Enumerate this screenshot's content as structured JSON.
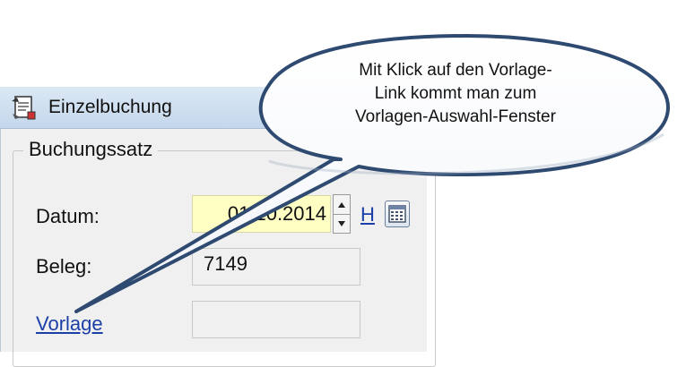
{
  "window": {
    "title": "Einzelbuchung",
    "group_title": "Buchungssatz"
  },
  "fields": {
    "datum_label": "Datum:",
    "datum_value": "01.10.2014",
    "beleg_label": "Beleg:",
    "beleg_value": "7149",
    "vorlage_link": "Vorlage",
    "vorlage_value": "",
    "h_link": "H"
  },
  "icons": {
    "app": "notepad-app-icon",
    "spin_up": "spin-up-icon",
    "spin_down": "spin-down-icon",
    "calendar": "calendar-icon"
  },
  "callout": {
    "text": "Mit Klick auf den Vorlage-\nLink kommt man zum\nVorlagen-Auswahl-Fenster"
  },
  "colors": {
    "date_field_bg": "#ffffc4",
    "link": "#1b3fa6",
    "callout_border": "#2e4a70"
  }
}
